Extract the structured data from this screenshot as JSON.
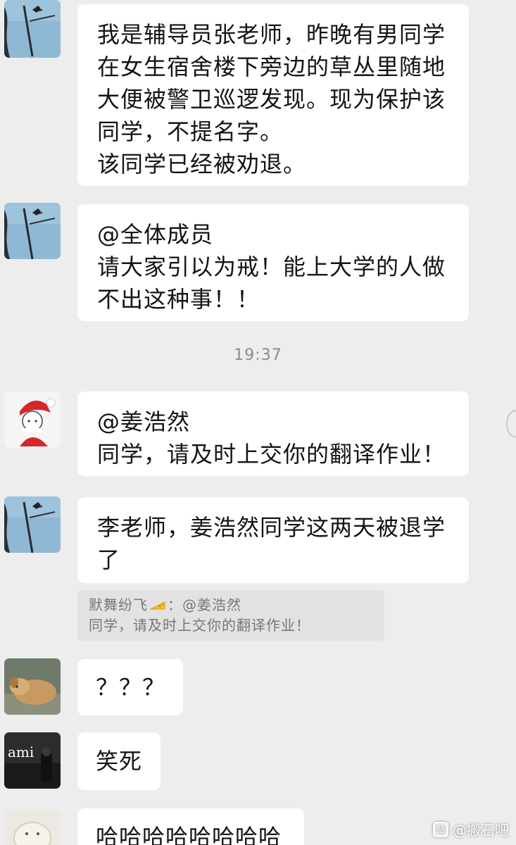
{
  "messages": [
    {
      "lines": [
        "我是辅导员张老师，昨晚有男同学",
        "在女生宿舍楼下旁边的草丛里随地",
        "大便被警卫巡逻发现。现为保护该",
        "同学，不提名字。",
        "该同学已经被劝退。"
      ]
    },
    {
      "lines": [
        "@全体成员",
        "请大家引以为戒！能上大学的人做",
        "不出这种事！！"
      ]
    },
    {
      "lines": [
        "@姜浩然",
        "同学，请及时上交你的翻译作业！"
      ]
    },
    {
      "lines": [
        "李老师，姜浩然同学这两天被退学",
        "了"
      ]
    },
    {
      "lines": [
        "？？？"
      ]
    },
    {
      "lines": [
        "笑死"
      ]
    },
    {
      "lines": [
        "哈哈哈哈哈哈哈哈"
      ]
    }
  ],
  "time_divider": "19:37",
  "quote": {
    "sender": "默舞纷飞",
    "separator": "：@姜浩然",
    "text": "同学，请及时上交你的翻译作业！"
  },
  "avatar_labels": {
    "ami": "ami"
  },
  "watermark": {
    "logo": "贴",
    "text": "@搬石吧"
  },
  "colors": {
    "background": "#ededed",
    "bubble": "#ffffff",
    "quote_bg": "#e2e2e2",
    "time_text": "#8c8c8c"
  }
}
